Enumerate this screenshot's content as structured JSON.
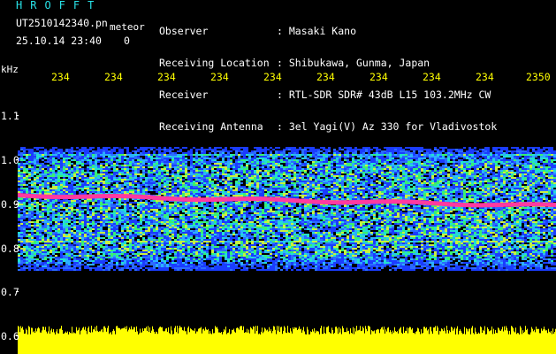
{
  "header": {
    "logo": "HROFFT",
    "filename": "UT2510142340.pn",
    "type": "meteor",
    "datetime": "25.10.14 23:40",
    "count": "0"
  },
  "info": {
    "labels": [
      "Observer",
      "Receiving Location",
      "Receiver",
      "Receiving Antenna"
    ],
    "values": [
      ": Masaki Kano",
      ": Shibukawa, Gunma, Japan",
      ": RTL-SDR SDR# 43dB L15 103.2MHz CW",
      ": 3el Yagi(V) Az 330 for Vladivostok"
    ]
  },
  "axis": {
    "freq_unit": "kHz",
    "freq_ticks": [
      "1.1",
      "1.0",
      "0.9",
      "0.8",
      "0.7",
      "0.6"
    ],
    "time_ticks": [
      "234",
      "234",
      "234",
      "234",
      "234",
      "234",
      "234",
      "234",
      "234",
      "2350"
    ]
  },
  "colors": {
    "background": "#000000",
    "header_cyan": "#28e2e8",
    "axis_yellow": "#ffff00",
    "signal_magenta": "#ff3aa0",
    "noise_blue": "#1a3cff"
  }
}
